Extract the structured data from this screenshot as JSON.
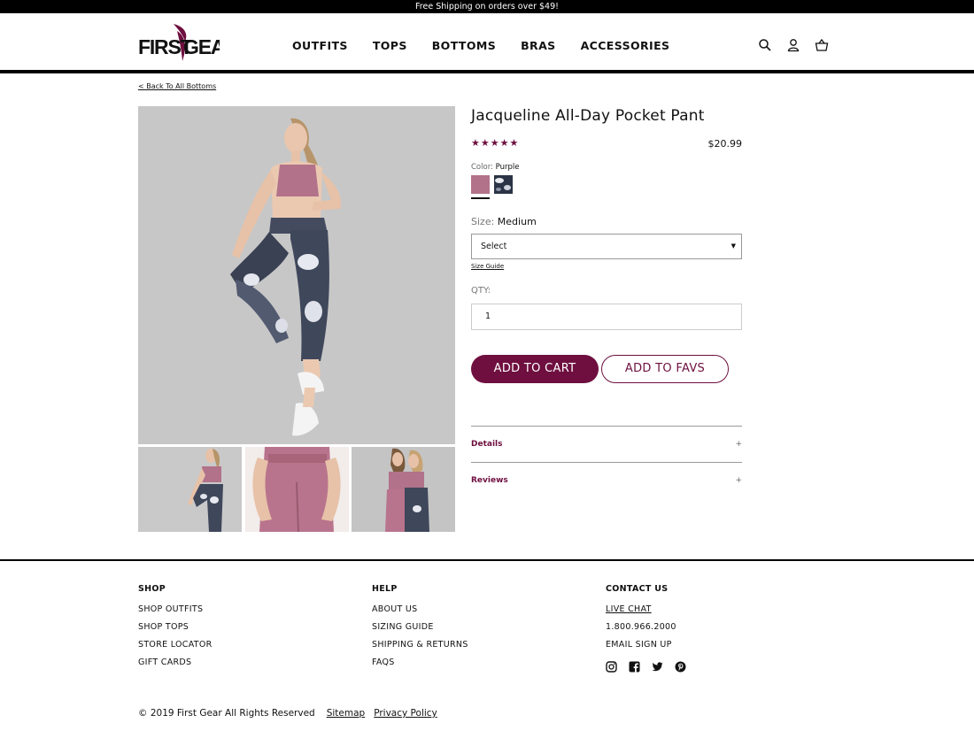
{
  "promo": {
    "text": "Free Shipping on orders over $49!"
  },
  "brand": {
    "logo_text": "FIRSTGEAR",
    "accent": "#6e0f3f"
  },
  "nav": {
    "items": [
      "OUTFITS",
      "TOPS",
      "BOTTOMS",
      "BRAS",
      "ACCESSORIES"
    ]
  },
  "header_icons": [
    "search-icon",
    "user-icon",
    "basket-icon"
  ],
  "breadcrumb": {
    "back": "< Back To All Bottoms"
  },
  "product": {
    "title": "Jacqueline All-Day Pocket Pant",
    "rating_stars": "★★★★★",
    "rating": 5,
    "price": "$20.99",
    "color_label": "Color:",
    "color_value": "Purple",
    "swatches": [
      "#b2728a",
      "#2b3445"
    ],
    "size_label": "Size:",
    "size_value": "Medium",
    "size_select": "Select",
    "size_guide": "Size Guide",
    "qty_label": "QTY:",
    "qty_value": "1",
    "add_to_cart": "ADD TO CART",
    "add_to_favs": "ADD TO FAVS",
    "accordions": [
      {
        "label": "Details",
        "icon": "+"
      },
      {
        "label": "Reviews",
        "icon": "+"
      }
    ]
  },
  "footer": {
    "shop": {
      "title": "SHOP",
      "links": [
        "SHOP OUTFITS",
        "SHOP TOPS",
        "STORE LOCATOR",
        "GIFT CARDS"
      ]
    },
    "help": {
      "title": "HELP",
      "links": [
        "ABOUT US",
        "SIZING GUIDE",
        "SHIPPING & RETURNS",
        "FAQS"
      ]
    },
    "contact": {
      "title": "CONTACT US",
      "links": [
        "LIVE CHAT",
        "1.800.966.2000",
        "EMAIL SIGN UP"
      ]
    },
    "social": [
      "instagram-icon",
      "facebook-icon",
      "twitter-icon",
      "pinterest-icon"
    ],
    "copyright": "© 2019 First Gear All Rights Reserved",
    "sitemap": "Sitemap",
    "privacy": "Privacy Policy"
  }
}
